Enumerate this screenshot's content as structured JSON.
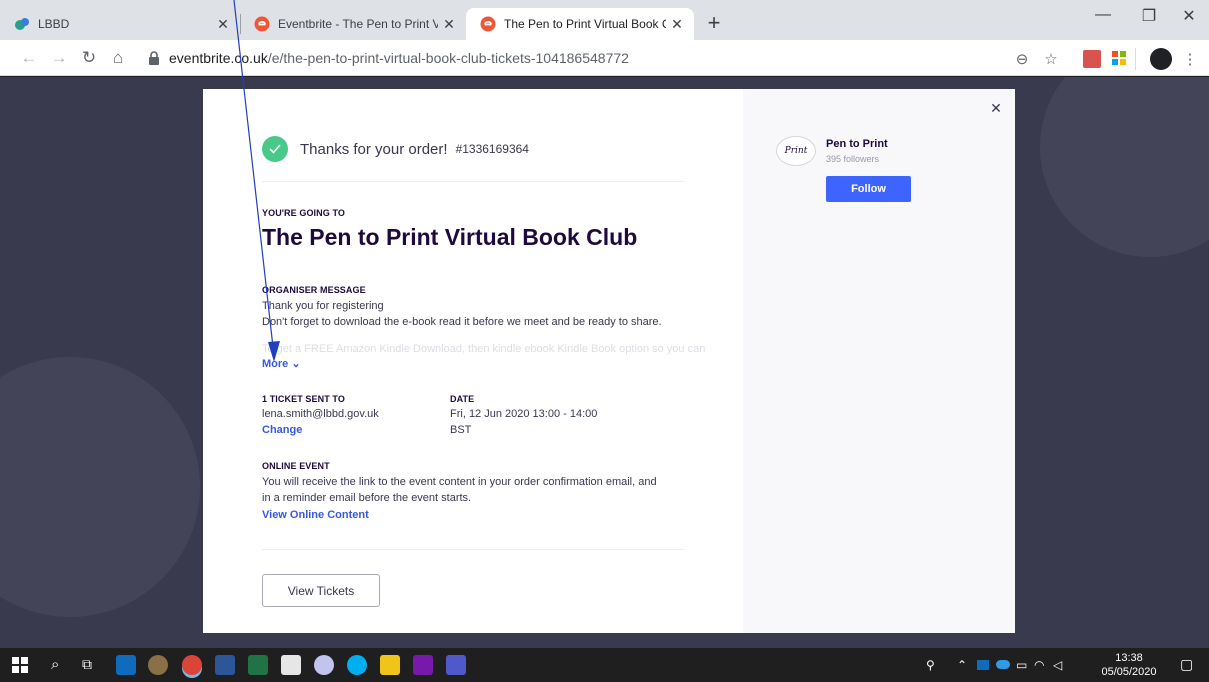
{
  "browser": {
    "tabs": [
      {
        "title": "LBBD",
        "active": false
      },
      {
        "title": "Eventbrite - The Pen to Print Virtu",
        "active": false
      },
      {
        "title": "The Pen to Print Virtual Book Clu",
        "active": true
      }
    ],
    "url_host": "eventbrite.co.uk",
    "url_path": "/e/the-pen-to-print-virtual-book-club-tickets-104186548772"
  },
  "modal": {
    "thanks_text": "Thanks for your order!",
    "order_number": "#1336169364",
    "going_label": "YOU'RE GOING TO",
    "event_title": "The Pen to Print Virtual Book Club",
    "organiser_label": "ORGANISER MESSAGE",
    "message_line1": "Thank you for registering",
    "message_line2": "Don't forget to download the e-book read it before we meet and be ready to share.",
    "message_faded": "To get a FREE Amazon Kindle Download, then kindle ebook Kindle Book option so you can",
    "more_label": "More",
    "ticket_label": "1 TICKET SENT TO",
    "ticket_email": "lena.smith@lbbd.gov.uk",
    "change_label": "Change",
    "date_label": "DATE",
    "date_line1": "Fri, 12 Jun 2020 13:00 - 14:00",
    "date_line2": "BST",
    "online_label": "ONLINE EVENT",
    "online_line1": "You will receive the link to the event content in your order confirmation email, and",
    "online_line2": "in a reminder email before the event starts.",
    "view_online_label": "View Online Content",
    "view_tickets_label": "View Tickets"
  },
  "organiser": {
    "name": "Pen to Print",
    "followers": "395 followers",
    "follow_label": "Follow"
  },
  "taskbar": {
    "time": "13:38",
    "date": "05/05/2020"
  },
  "colors": {
    "accent": "#3d64ff",
    "link": "#3659e3",
    "success": "#48c98a",
    "annotation": "#1f3fbf"
  }
}
